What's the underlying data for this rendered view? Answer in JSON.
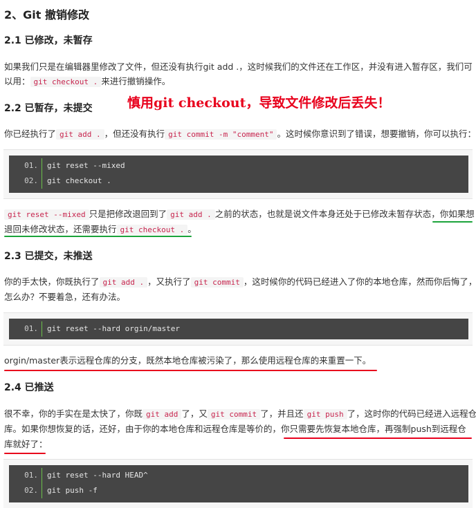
{
  "sec2_title": "2、Git 撤销修改",
  "s21": {
    "title": "2.1 已修改，未暂存",
    "p1": "如果我们只是在编辑器里修改了文件，但还没有执行git add .，这时候我们的文件还在工作区，并没有进入暂存区，我们可",
    "p2_a": "以用：",
    "p2_code": "git checkout .",
    "p2_b": "来进行撤销操作。"
  },
  "annotation": "慎用git checkout，导致文件修改后丢失！",
  "s22": {
    "title": "2.2 已暂存，未提交",
    "p_a": "你已经执行了",
    "p_code1": "git add .",
    "p_b": "，但还没有执行",
    "p_code2": "git commit -m \"comment\"",
    "p_c": "。这时候你意识到了错误，想要撤销，你可以执行：",
    "code": [
      {
        "n": "01.",
        "t": "git reset --mixed"
      },
      {
        "n": "02.",
        "t": "git checkout ."
      }
    ],
    "after1_code1": "git reset --mixed",
    "after1_a": "只是把修改退回到了",
    "after1_code2": "git add .",
    "after1_b": "之前的状态，也就是说文件本身还处于已修改未暂存状态，",
    "after1_c": "你如果想",
    "after2_a": "退回未修改状态，还需要执行",
    "after2_code": "git checkout .",
    "after2_b": "。"
  },
  "s23": {
    "title": "2.3 已提交，未推送",
    "p1_a": "你的手太快，你既执行了",
    "p1_code1": "git add .",
    "p1_b": "，又执行了",
    "p1_code2": "git commit",
    "p1_c": "，这时候你的代码已经进入了你的本地仓库，然而你后悔了，",
    "p2": "怎么办？不要着急，还有办法。",
    "code": [
      {
        "n": "01.",
        "t": "git reset --hard orgin/master"
      }
    ],
    "after": "orgin/master表示远程仓库的分支，既然本地仓库被污染了，那么使用远程仓库的来重置一下。"
  },
  "s24": {
    "title": "2.4 已推送",
    "p1_a": "很不幸，你的手实在是太快了，你既",
    "p1_code1": "git add",
    "p1_b": "了，又",
    "p1_code2": "git commit",
    "p1_c": "了，并且还",
    "p1_code3": "git push",
    "p1_d": "了，这时你的代码已经进入远程仓",
    "p2_a": "库。如果你想恢复的话，还好，由于你的本地仓库和远程仓库是等价的，",
    "p2_b": "你只需要先恢复本地仓库，再强制push到远程仓",
    "p3": "库就好了：",
    "code": [
      {
        "n": "01.",
        "t": "git reset --hard HEAD^"
      },
      {
        "n": "02.",
        "t": "git push -f"
      }
    ]
  },
  "colors": {
    "annotation": "#e8001c",
    "underline_red": "#e8001c",
    "underline_green": "#1aa33a",
    "code_bg": "#454545",
    "inline_code": "#c7254e"
  }
}
